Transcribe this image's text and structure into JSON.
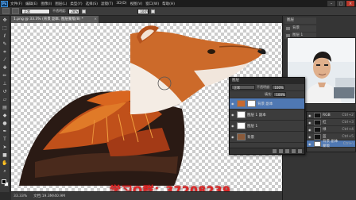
{
  "app": {
    "logo": "Ps",
    "menu": [
      "文件(F)",
      "编辑(E)",
      "图像(I)",
      "图层(L)",
      "类型(Y)",
      "选择(S)",
      "滤镜(T)",
      "3D(D)",
      "视图(V)",
      "窗口(W)",
      "帮助(H)"
    ],
    "window_buttons": [
      "–",
      "□",
      "×"
    ]
  },
  "options_bar": {
    "mode_value": "正常",
    "opacity_label": "不透明度:",
    "opacity_value": "28%",
    "flow_value": "100%"
  },
  "document": {
    "tab_title": "1.png @ 33.3% (背景 副本, 图层蒙版/8) *",
    "tab_close": "×",
    "zoom": "33.33%",
    "doc_info": "文档:19.3M/40.9M"
  },
  "watermark": "学习Q群：37208239",
  "right_dock": {
    "top_tab": "图层",
    "rows": [
      "背景",
      "图层 1",
      "图层 2",
      "属性"
    ]
  },
  "layers_panel": {
    "title": "图层",
    "blend_mode": "正常",
    "opacity_label": "不透明度:",
    "opacity_value": "100%",
    "fill_label": "填充:",
    "fill_value": "100%",
    "layers": [
      {
        "name": "背景 副本",
        "selected": true
      },
      {
        "name": "图层 1 副本",
        "selected": false
      },
      {
        "name": "图层 1",
        "selected": false
      },
      {
        "name": "背景",
        "selected": false
      }
    ]
  },
  "channels_panel": {
    "rows": [
      {
        "name": "RGB",
        "key": "Ctrl+2",
        "selected": false
      },
      {
        "name": "红",
        "key": "Ctrl+3",
        "selected": false
      },
      {
        "name": "绿",
        "key": "Ctrl+4",
        "selected": false
      },
      {
        "name": "蓝",
        "key": "Ctrl+5",
        "selected": false
      },
      {
        "name": "背景 副本 蒙版",
        "key": "Ctrl+\\",
        "selected": true
      }
    ]
  },
  "tools": [
    "move-tool",
    "marquee-tool",
    "lasso-tool",
    "quick-select-tool",
    "crop-tool",
    "eyedropper-tool",
    "healing-tool",
    "brush-tool",
    "clone-stamp-tool",
    "history-brush-tool",
    "eraser-tool",
    "gradient-tool",
    "blur-tool",
    "dodge-tool",
    "pen-tool",
    "type-tool",
    "path-select-tool",
    "shape-tool",
    "hand-tool",
    "zoom-tool"
  ],
  "colors": {
    "foreground": "#000000",
    "background": "#ffffff",
    "selection": "#4f78b3",
    "watermark": "#e02424"
  }
}
